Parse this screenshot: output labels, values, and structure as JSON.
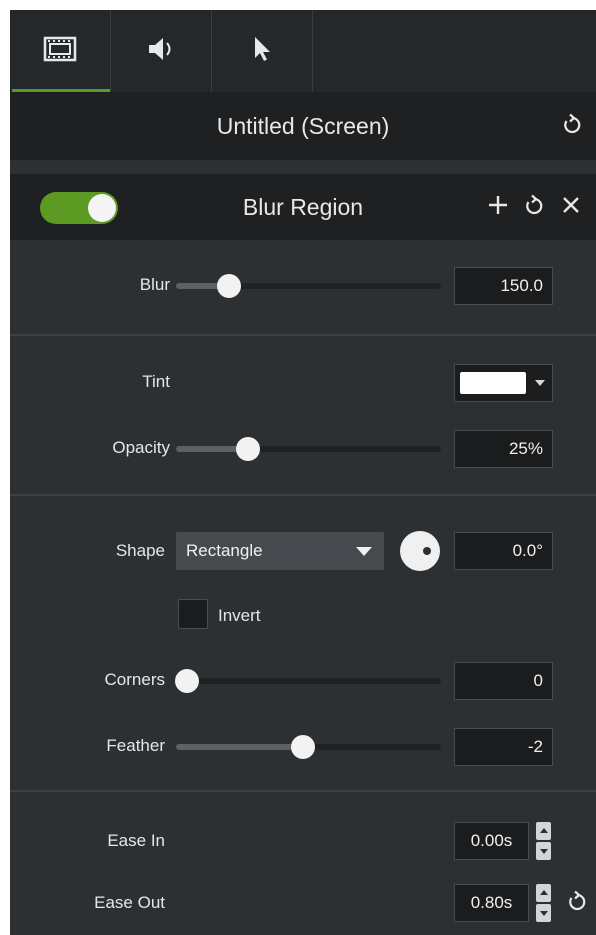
{
  "tabs": [
    {
      "name": "visual-properties",
      "icon": "film-icon",
      "active": true
    },
    {
      "name": "audio-properties",
      "icon": "speaker-icon",
      "active": false
    },
    {
      "name": "cursor-properties",
      "icon": "cursor-icon",
      "active": false
    }
  ],
  "header": {
    "title": "Untitled (Screen)"
  },
  "effect": {
    "title": "Blur Region",
    "enabled": true
  },
  "blur": {
    "label": "Blur",
    "value": "150.0",
    "slider_fraction": 0.2
  },
  "tint": {
    "label": "Tint",
    "color": "#ffffff"
  },
  "opacity": {
    "label": "Opacity",
    "value": "25%",
    "slider_fraction": 0.27
  },
  "shape": {
    "label": "Shape",
    "selected": "Rectangle",
    "angle": "0.0°"
  },
  "invert": {
    "label": "Invert",
    "checked": false
  },
  "corners": {
    "label": "Corners",
    "value": "0",
    "slider_fraction": 0.04
  },
  "feather": {
    "label": "Feather",
    "value": "-2",
    "slider_fraction": 0.48
  },
  "ease_in": {
    "label": "Ease In",
    "value": "0.00s"
  },
  "ease_out": {
    "label": "Ease Out",
    "value": "0.80s"
  },
  "colors": {
    "accent_green": "#5c9a23",
    "panel_bg": "#2d3033",
    "header_bg": "#1e2022"
  }
}
